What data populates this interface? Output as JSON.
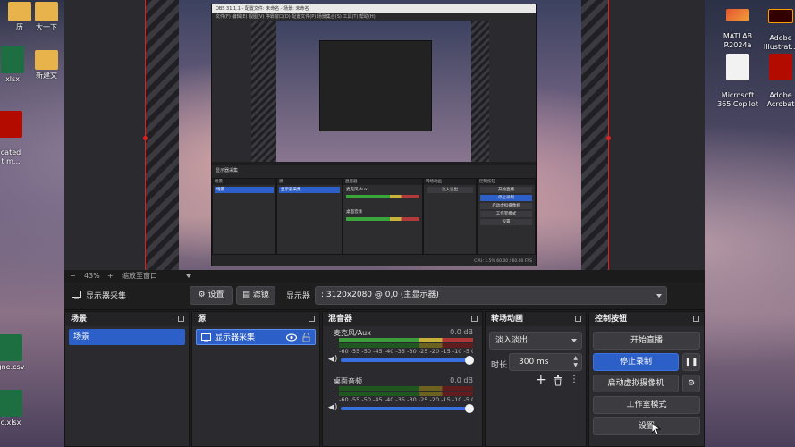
{
  "desktop": {
    "left_icons": [
      {
        "label": "历",
        "kind": "folder"
      },
      {
        "label": "大一下",
        "kind": "folder"
      },
      {
        "label": "xlsx",
        "kind": "excel"
      },
      {
        "label": "新建文",
        "kind": "folder"
      },
      {
        "label": "cated\nt m...",
        "kind": "pdf"
      },
      {
        "label": "gne.csv",
        "kind": "excel"
      },
      {
        "label": "c.xlsx",
        "kind": "excel"
      }
    ],
    "right_icons": [
      {
        "label": "MATLAB\nR2024a",
        "kind": "matlab"
      },
      {
        "label": "Adobe\nIllustrat...",
        "kind": "ai"
      },
      {
        "label": "Microsoft\n365 Copilot",
        "kind": "doc"
      },
      {
        "label": "Adobe\nAcrobat",
        "kind": "pdf"
      }
    ]
  },
  "obs": {
    "inner": {
      "title": "OBS 31.1.1 - 配置文件: 未命名 - 场景: 未命名",
      "menu": "文件(F)  编辑(E)  视图(V)  停靠窗口(D)  配置文件(P)  场景集合(S)  工具(T)  帮助(H)",
      "source_name": "显示器采集",
      "scenes_label": "场景",
      "scene": "场景",
      "sources_label": "源",
      "mixer_label": "混音器",
      "mic": "麦克风/Aux",
      "desktop_audio": "桌面音频",
      "transitions_label": "转场动画",
      "fade": "淡入淡出",
      "controls_label": "控制按钮",
      "start_stream": "开始直播",
      "stop_record": "停止录制",
      "virtual_cam": "启动虚拟摄像机",
      "studio": "工作室模式",
      "settings": "设置",
      "status": "CPU: 1.5%   60.00 / 60.00 FPS"
    },
    "zoom": {
      "minus": "−",
      "value": "43%",
      "plus": "+",
      "fit": "缩放至窗口"
    },
    "source_toolbar": {
      "source_name": "显示器采集",
      "settings_label": "设置",
      "filters_label": "滤镜",
      "display_label": "显示器",
      "display_value": ": 3120x2080 @ 0,0 (主显示器)"
    },
    "scenes": {
      "title": "场景",
      "items": [
        "场景"
      ]
    },
    "sources": {
      "title": "源",
      "items": [
        {
          "name": "显示器采集"
        }
      ]
    },
    "mixer": {
      "title": "混音器",
      "channels": [
        {
          "name": "麦克风/Aux",
          "db": "0.0 dB",
          "scale": "-60 -55 -50 -45 -40 -35 -30 -25 -20 -15 -10 -5 0",
          "volume_fraction": 1.0
        },
        {
          "name": "桌面音频",
          "db": "0.0 dB",
          "scale": "-60 -55 -50 -45 -40 -35 -30 -25 -20 -15 -10 -5 0",
          "volume_fraction": 1.0
        }
      ]
    },
    "transitions": {
      "title": "转场动画",
      "selected": "淡入淡出",
      "duration_label": "时长",
      "duration_value": "300 ms"
    },
    "controls": {
      "title": "控制按钮",
      "start_stream": "开始直播",
      "stop_record": "停止录制",
      "virtual_cam": "启动虚拟摄像机",
      "studio_mode": "工作室模式",
      "settings": "设置"
    }
  },
  "colors": {
    "accent": "#2c5fc7",
    "panel": "#2b2a2e",
    "bg": "#1f1e1f",
    "red_bounds": "#e02020"
  }
}
